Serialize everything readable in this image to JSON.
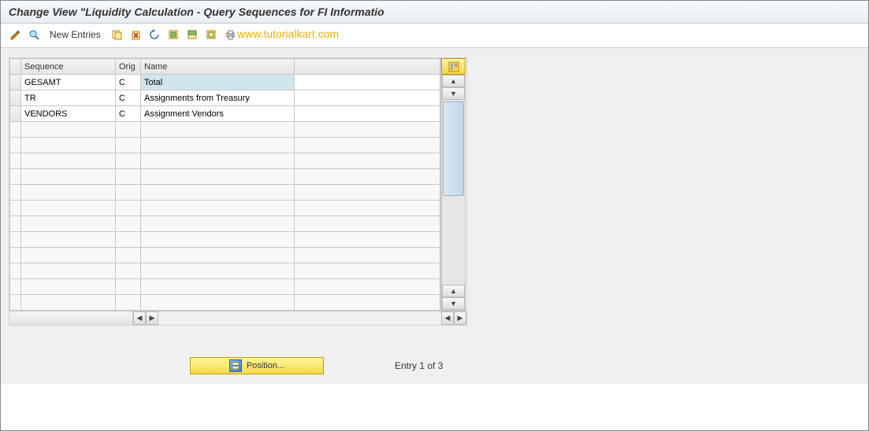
{
  "title": "Change View \"Liquidity Calculation - Query Sequences for FI Informatio",
  "toolbar": {
    "new_entries_label": "New Entries"
  },
  "watermark": "www.tutorialkart.com",
  "columns": {
    "sequence": "Sequence",
    "orig": "Orig",
    "name": "Name"
  },
  "rows": [
    {
      "sequence": "GESAMT",
      "orig": "C",
      "name": "Total",
      "selected": true
    },
    {
      "sequence": "TR",
      "orig": "C",
      "name": "Assignments from Treasury",
      "selected": false
    },
    {
      "sequence": "VENDORS",
      "orig": "C",
      "name": "Assignment Vendors",
      "selected": false
    }
  ],
  "empty_rows": 12,
  "footer": {
    "position_label": "Position...",
    "entry_info": "Entry 1 of 3"
  }
}
